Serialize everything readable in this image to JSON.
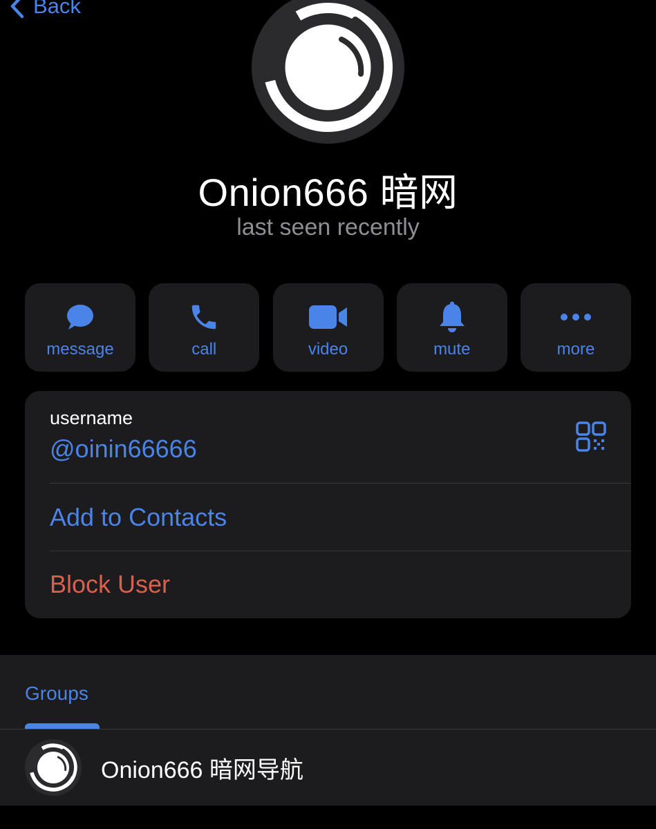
{
  "nav": {
    "back_label": "Back"
  },
  "profile": {
    "name": "Onion666 暗网",
    "status": "last seen recently"
  },
  "actions": [
    {
      "label": "message",
      "icon": "message-icon"
    },
    {
      "label": "call",
      "icon": "phone-icon"
    },
    {
      "label": "video",
      "icon": "video-camera-icon"
    },
    {
      "label": "mute",
      "icon": "bell-icon"
    },
    {
      "label": "more",
      "icon": "ellipsis-icon"
    }
  ],
  "info": {
    "username_label": "username",
    "username_value": "@oinin66666",
    "add_contacts": "Add to Contacts",
    "block_user": "Block User"
  },
  "groups": {
    "tab_label": "Groups",
    "items": [
      {
        "name": "Onion666 暗网导航"
      }
    ]
  },
  "colors": {
    "accent": "#4a84e8",
    "danger": "#d8604d",
    "background": "#000000",
    "card": "#1c1c1e",
    "secondary_text": "#8e8e93"
  }
}
